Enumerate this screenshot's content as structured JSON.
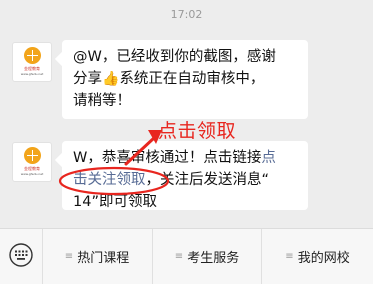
{
  "chat": {
    "timestamp": "17:02",
    "account_avatar": {
      "brand_text": "金程教育",
      "brand_url": "www.gfedu.net"
    },
    "messages": [
      {
        "lines": [
          "@W，已经收到你的截图，感谢",
          "系统正在自动审核中，",
          "请稍等！"
        ],
        "share_word": "分享",
        "emoji": "👍"
      },
      {
        "line1_prefix": "W，恭喜审核通过！点击链接",
        "link_part1": "点",
        "link_part2": "击关注领取",
        "line2_suffix": "，关注后发送消息“",
        "line3": "14”即可领取"
      }
    ]
  },
  "annotation": {
    "label": "点击领取",
    "color": "#e8261f"
  },
  "bottom_menu": {
    "items": [
      {
        "label": "热门课程"
      },
      {
        "label": "考生服务"
      },
      {
        "label": "我的网校"
      }
    ]
  }
}
